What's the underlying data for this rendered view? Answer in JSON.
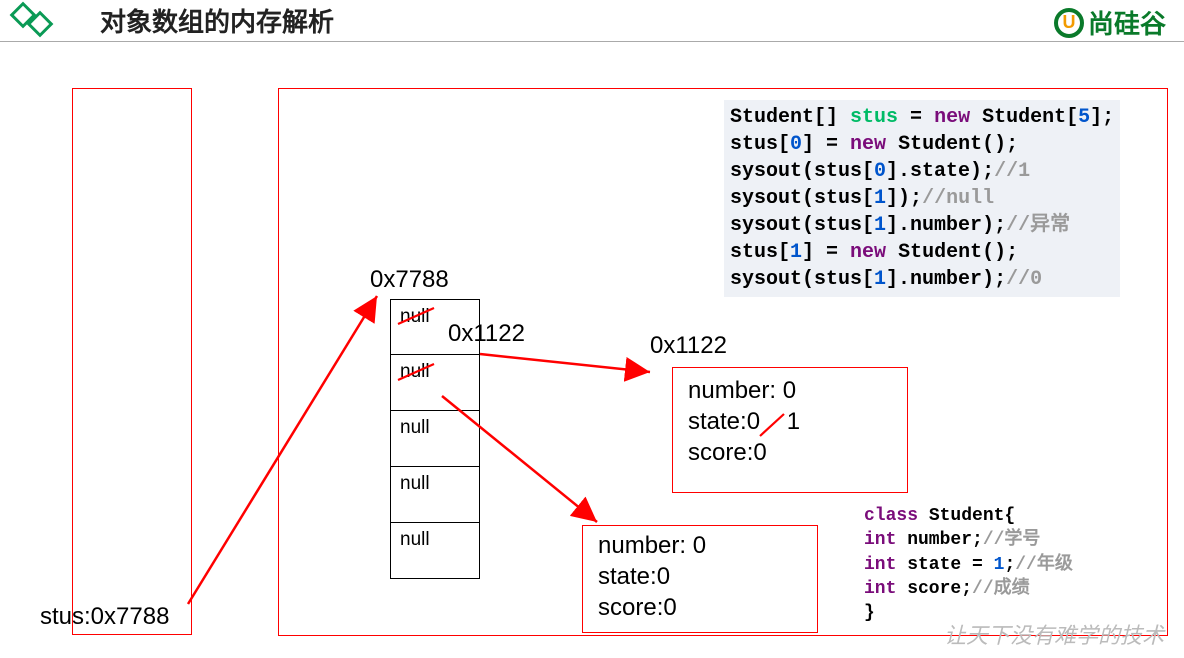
{
  "header": {
    "title": "对象数组的内存解析",
    "brand": "尚硅谷",
    "brand_glyph": "U"
  },
  "stack": {
    "label_stus": "stus:0x7788"
  },
  "heap": {
    "array_addr_label": "0x7788",
    "array_cells": [
      "null",
      "null",
      "null",
      "null",
      "null"
    ],
    "pointer_to_obj1_label": "0x1122",
    "obj1_addr_label": "0x1122",
    "obj1": {
      "number_label": "number: 0",
      "state_label_old": "state:0",
      "state_label_new": "1",
      "score_label": "score:0"
    },
    "obj2": {
      "number_label": "number: 0",
      "state_label": "state:0",
      "score_label": "score:0"
    }
  },
  "code_main": {
    "l1_a": "Student[] ",
    "l1_b": "stus",
    "l1_c": " = ",
    "l1_d": "new",
    "l1_e": " Student[",
    "l1_f": "5",
    "l1_g": "];",
    "l2_a": "stus[",
    "l2_b": "0",
    "l2_c": "] = ",
    "l2_d": "new",
    "l2_e": " Student();",
    "l3_a": "sysout(stus[",
    "l3_b": "0",
    "l3_c": "].state);",
    "l3_d": "//1",
    "l4_a": "sysout(stus[",
    "l4_b": "1",
    "l4_c": "]);",
    "l4_d": "//null",
    "l5_a": "sysout(stus[",
    "l5_b": "1",
    "l5_c": "].number);",
    "l5_d": "//异常",
    "l6_a": "stus[",
    "l6_b": "1",
    "l6_c": "] = ",
    "l6_d": "new",
    "l6_e": " Student();",
    "l7_a": "sysout(stus[",
    "l7_b": "1",
    "l7_c": "].number);",
    "l7_d": "//0"
  },
  "code_class": {
    "l1_a": "class",
    "l1_b": " Student{",
    "l2_a": "int",
    "l2_b": " number;",
    "l2_c": "//学号",
    "l3_a": "int",
    "l3_b": " state = ",
    "l3_c": "1",
    "l3_d": ";",
    "l3_e": "//年级",
    "l4_a": "int",
    "l4_b": " score;",
    "l4_c": "//成绩",
    "l5": "}"
  },
  "watermark": "让天下没有难学的技术"
}
